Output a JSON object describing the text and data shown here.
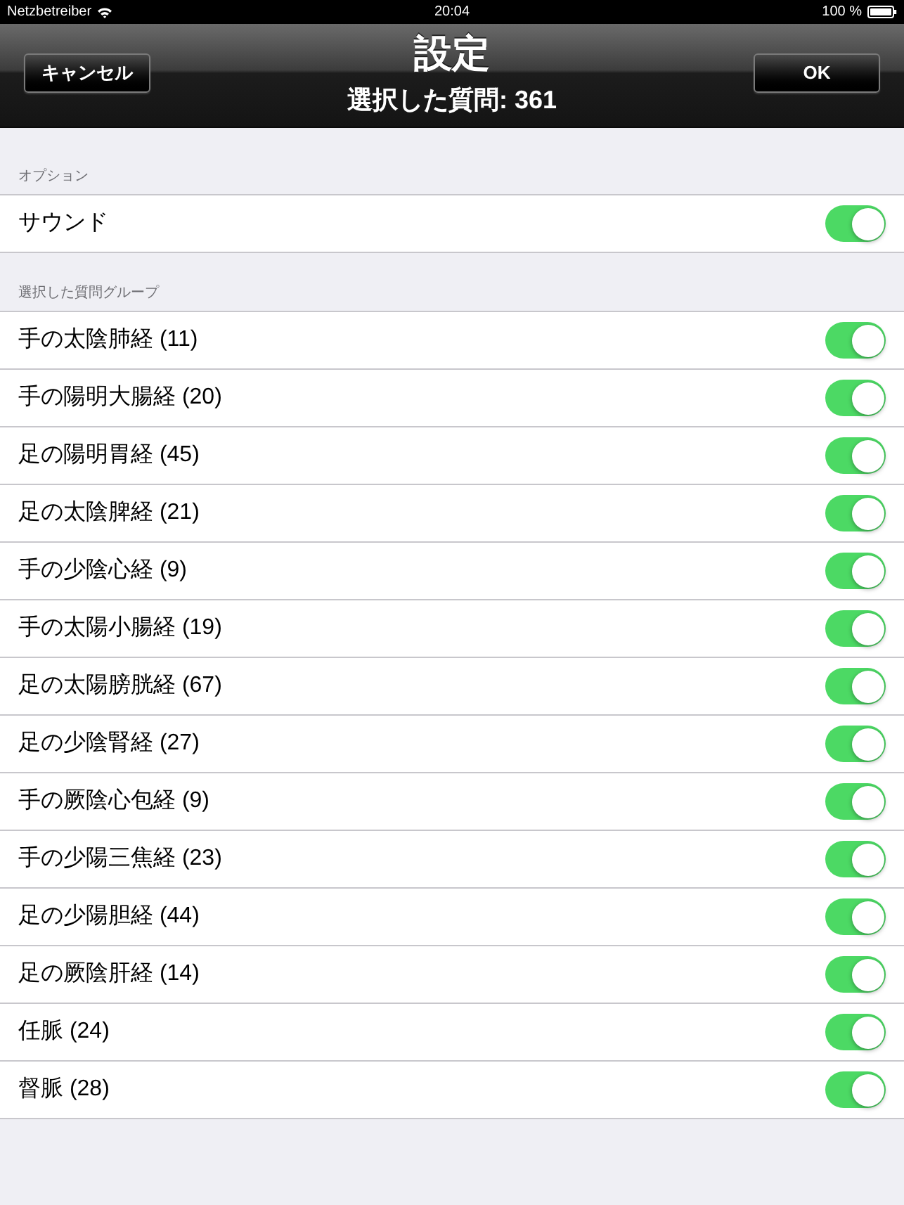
{
  "status_bar": {
    "carrier": "Netzbetreiber",
    "time": "20:04",
    "battery": "100 %"
  },
  "nav_bar": {
    "title": "設定",
    "subtitle": "選択した質問: 361",
    "left_button": "キャンセル",
    "right_button": "OK"
  },
  "sections": [
    {
      "header": "オプション",
      "rows": [
        {
          "label": "サウンド",
          "on": true
        }
      ]
    },
    {
      "header": "選択した質問グループ",
      "rows": [
        {
          "label": "手の太陰肺経 (11)",
          "on": true
        },
        {
          "label": "手の陽明大腸経 (20)",
          "on": true
        },
        {
          "label": "足の陽明胃経 (45)",
          "on": true
        },
        {
          "label": "足の太陰脾経 (21)",
          "on": true
        },
        {
          "label": "手の少陰心経 (9)",
          "on": true
        },
        {
          "label": "手の太陽小腸経 (19)",
          "on": true
        },
        {
          "label": "足の太陽膀胱経 (67)",
          "on": true
        },
        {
          "label": "足の少陰腎経 (27)",
          "on": true
        },
        {
          "label": "手の厥陰心包経 (9)",
          "on": true
        },
        {
          "label": "手の少陽三焦経 (23)",
          "on": true
        },
        {
          "label": "足の少陽胆経 (44)",
          "on": true
        },
        {
          "label": "足の厥陰肝経 (14)",
          "on": true
        },
        {
          "label": "任脈 (24)",
          "on": true
        },
        {
          "label": "督脈 (28)",
          "on": true
        }
      ]
    }
  ]
}
